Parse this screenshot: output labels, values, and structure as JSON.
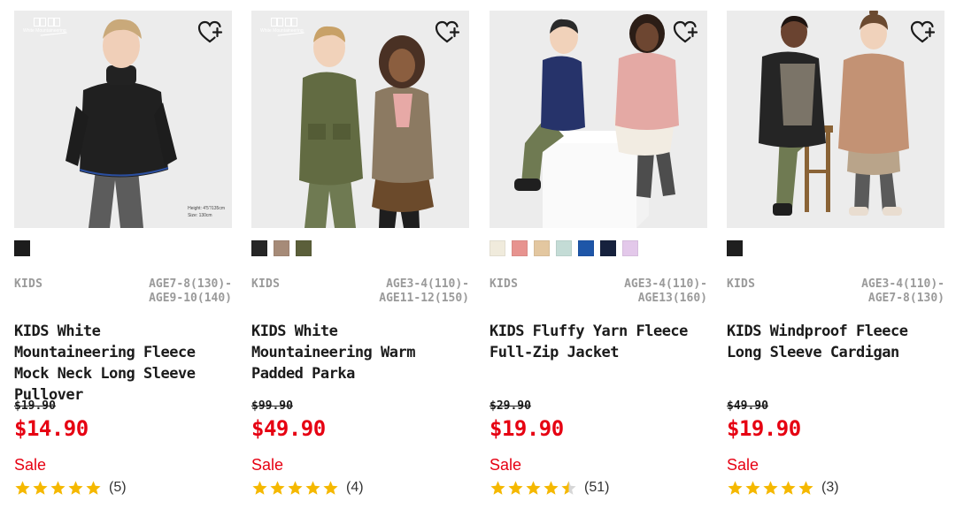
{
  "products": [
    {
      "gender": "KIDS",
      "sizes": [
        "AGE7-8(130)-",
        "AGE9-10(140)"
      ],
      "name": "KIDS White Mountaineering Fleece Mock Neck Long Sleeve Pullover",
      "original_price": "$19.90",
      "sale_price": "$14.90",
      "flag": "Sale",
      "rating": 5,
      "review_count": "(5)",
      "swatches": [
        "#1c1c1c"
      ],
      "has_brand_tag": true,
      "brand_tag_text": "White Mountaineering",
      "size_note": [
        "Height: 4'5\"/135cm",
        "Size: 130cm"
      ],
      "image_bg": "#ececec"
    },
    {
      "gender": "KIDS",
      "sizes": [
        "AGE3-4(110)-",
        "AGE11-12(150)"
      ],
      "name": "KIDS White Mountaineering Warm Padded Parka",
      "original_price": "$99.90",
      "sale_price": "$49.90",
      "flag": "Sale",
      "rating": 5,
      "review_count": "(4)",
      "swatches": [
        "#262626",
        "#a68b78",
        "#5b5f3a"
      ],
      "has_brand_tag": true,
      "brand_tag_text": "White Mountaineering",
      "size_note": [],
      "image_bg": "#ececec"
    },
    {
      "gender": "KIDS",
      "sizes": [
        "AGE3-4(110)-",
        "AGE13(160)"
      ],
      "name": "KIDS Fluffy Yarn Fleece Full-Zip Jacket",
      "original_price": "$29.90",
      "sale_price": "$19.90",
      "flag": "Sale",
      "rating": 4.5,
      "review_count": "(51)",
      "swatches": [
        "#f0ebdc",
        "#e7938f",
        "#e3c7a0",
        "#c4dcd6",
        "#1e56a8",
        "#16213d",
        "#e3c8ea"
      ],
      "has_brand_tag": false,
      "brand_tag_text": "",
      "size_note": [],
      "image_bg": "#ececec"
    },
    {
      "gender": "KIDS",
      "sizes": [
        "AGE3-4(110)-",
        "AGE7-8(130)"
      ],
      "name": "KIDS Windproof Fleece Long Sleeve Cardigan",
      "original_price": "$49.90",
      "sale_price": "$19.90",
      "flag": "Sale",
      "rating": 5,
      "review_count": "(3)",
      "swatches": [
        "#1f1f1f"
      ],
      "has_brand_tag": false,
      "brand_tag_text": "",
      "size_note": [],
      "image_bg": "#ececec"
    }
  ],
  "icons": {
    "wishlist": "heart-plus-icon",
    "rating": "star-icon"
  },
  "colors": {
    "sale": "#e60012",
    "star": "#f5b800",
    "star_empty": "#d6d6d6",
    "muted": "#9a9a9a"
  }
}
